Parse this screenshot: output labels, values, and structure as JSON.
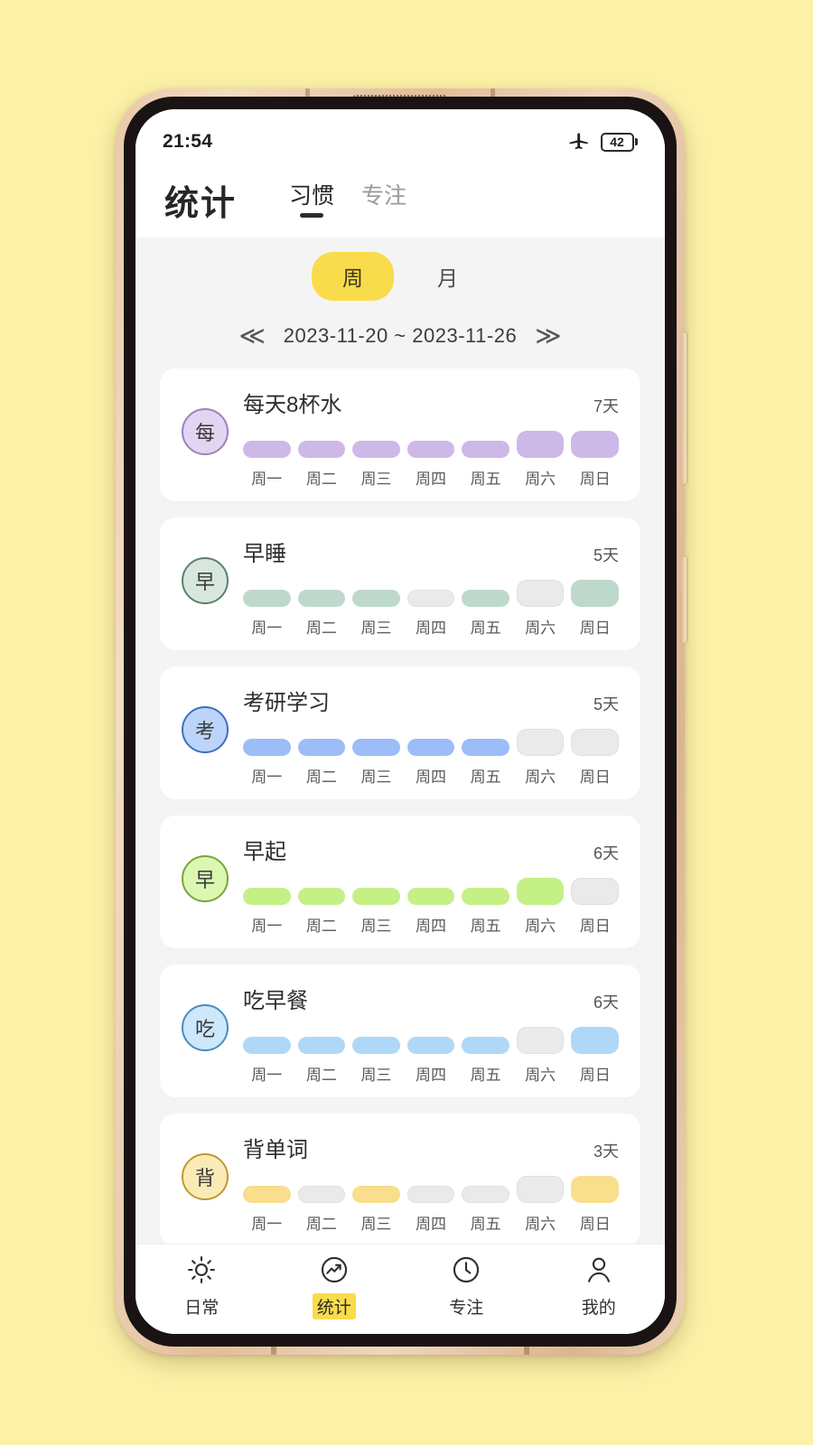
{
  "status_bar": {
    "time": "21:54",
    "airplane_icon": "airplane-mode-icon",
    "battery_level": "42"
  },
  "header": {
    "title": "统计",
    "tabs": [
      {
        "label": "习惯",
        "active": true
      },
      {
        "label": "专注",
        "active": false
      }
    ]
  },
  "period": {
    "options": [
      {
        "label": "周",
        "active": true
      },
      {
        "label": "月",
        "active": false
      }
    ],
    "prev_icon": "chevron-double-left-icon",
    "next_icon": "chevron-double-right-icon",
    "range_text": "2023-11-20  ~  2023-11-26"
  },
  "day_labels": [
    "周一",
    "周二",
    "周三",
    "周四",
    "周五",
    "周六",
    "周日"
  ],
  "colors": {
    "page_background": "#FCF2A7",
    "accent_yellow": "#F8DC4B",
    "card_background": "#FFFFFF",
    "screen_background": "#F4F4F4",
    "empty_bar": "#EAEAEA"
  },
  "habits": [
    {
      "avatar": "每",
      "name": "每天8杯水",
      "count": "7天",
      "fill": "#CDB8E8",
      "avatar_fill": "#E3D5F2",
      "avatar_border": "#9B82BE",
      "days": [
        true,
        true,
        true,
        true,
        true,
        true,
        true
      ]
    },
    {
      "avatar": "早",
      "name": "早睡",
      "count": "5天",
      "fill": "#BFD8CC",
      "avatar_fill": "#D7E7DE",
      "avatar_border": "#5F7F70",
      "days": [
        true,
        true,
        true,
        false,
        true,
        false,
        true
      ]
    },
    {
      "avatar": "考",
      "name": "考研学习",
      "count": "5天",
      "fill": "#9CBDF7",
      "avatar_fill": "#BDD4FA",
      "avatar_border": "#3E6FBF",
      "days": [
        true,
        true,
        true,
        true,
        true,
        false,
        false
      ]
    },
    {
      "avatar": "早",
      "name": "早起",
      "count": "6天",
      "fill": "#C4F086",
      "avatar_fill": "#DBF7B2",
      "avatar_border": "#77A63A",
      "days": [
        true,
        true,
        true,
        true,
        true,
        true,
        false
      ]
    },
    {
      "avatar": "吃",
      "name": "吃早餐",
      "count": "6天",
      "fill": "#AFD8F8",
      "avatar_fill": "#CDE7FB",
      "avatar_border": "#4A8CC0",
      "days": [
        true,
        true,
        true,
        true,
        true,
        false,
        true
      ]
    },
    {
      "avatar": "背",
      "name": "背单词",
      "count": "3天",
      "fill": "#F8DE8D",
      "avatar_fill": "#FAEAB6",
      "avatar_border": "#BE9A30",
      "days": [
        true,
        false,
        true,
        false,
        false,
        false,
        true
      ]
    }
  ],
  "bottom_nav": [
    {
      "label": "日常",
      "icon": "sun-icon",
      "active": false
    },
    {
      "label": "统计",
      "icon": "trending-chart-icon",
      "active": true
    },
    {
      "label": "专注",
      "icon": "clock-icon",
      "active": false
    },
    {
      "label": "我的",
      "icon": "person-icon",
      "active": false
    }
  ]
}
